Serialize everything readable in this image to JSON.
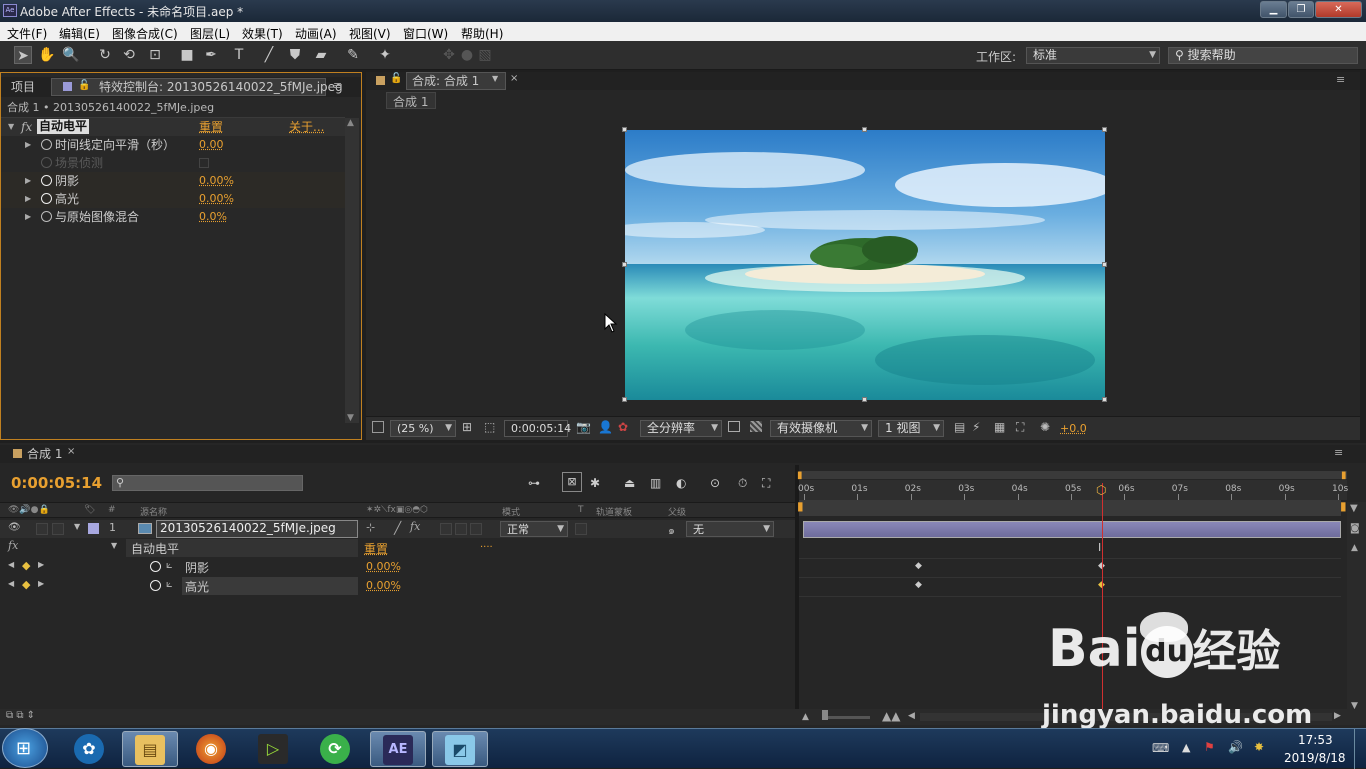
{
  "window": {
    "title": "Adobe After Effects - 未命名项目.aep *",
    "app_icon": "Ae"
  },
  "menu": [
    "文件(F)",
    "编辑(E)",
    "图像合成(C)",
    "图层(L)",
    "效果(T)",
    "动画(A)",
    "视图(V)",
    "窗口(W)",
    "帮助(H)"
  ],
  "toolbar": {
    "workspace_label": "工作区:",
    "workspace_value": "标准",
    "search_placeholder": "搜索帮助"
  },
  "project_panel": {
    "tab_project": "项目",
    "tab_effects": "特效控制台: 20130526140022_5fMJe.jpeg",
    "breadcrumb": "合成 1 • 20130526140022_5fMJe.jpeg",
    "effect_name": "自动电平",
    "reset": "重置",
    "about": "关于...",
    "params": [
      {
        "label": "时间线定向平滑（秒）",
        "value": "0.00"
      },
      {
        "label": "场景侦测",
        "value": ""
      },
      {
        "label": "阴影",
        "value": "0.00%"
      },
      {
        "label": "高光",
        "value": "0.00%"
      },
      {
        "label": "与原始图像混合",
        "value": "0.0%"
      }
    ]
  },
  "comp_panel": {
    "tab": "合成: 合成 1",
    "subtab": "合成 1",
    "zoom": "(25 %)",
    "timecode": "0:00:05:14",
    "resolution": "全分辨率",
    "camera": "有效摄像机",
    "views": "1 视图",
    "exposure": "+0.0"
  },
  "timeline": {
    "tab": "合成 1",
    "timecode": "0:00:05:14",
    "col_source": "源名称",
    "col_mode": "模式",
    "col_t": "T",
    "col_trkmat": "轨道蒙板",
    "col_parent": "父级",
    "layer_num": "1",
    "layer_name": "20130526140022_5fMJe.jpeg",
    "layer_mode": "正常",
    "layer_parent": "无",
    "effect_name": "自动电平",
    "effect_reset": "重置",
    "effect_dots": "....",
    "props": [
      {
        "label": "阴影",
        "value": "0.00%"
      },
      {
        "label": "高光",
        "value": "0.00%"
      }
    ],
    "ruler": [
      "00s",
      "01s",
      "02s",
      "03s",
      "04s",
      "05s",
      "06s",
      "07s",
      "08s",
      "09s",
      "10s"
    ],
    "playhead_seconds": 5.58
  },
  "taskbar": {
    "time": "17:53",
    "date": "2019/8/18",
    "ae_label": "AE"
  },
  "watermark": {
    "brand": "Bai",
    "brand2": "du",
    "cn": "经验",
    "url": "jingyan.baidu.com"
  }
}
